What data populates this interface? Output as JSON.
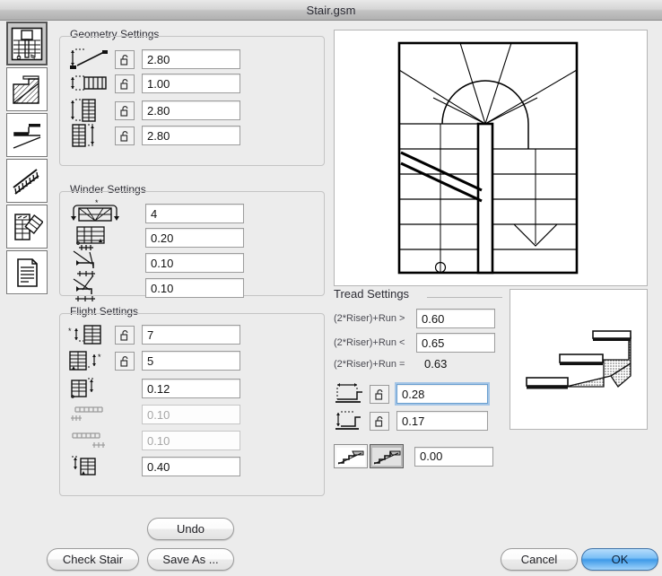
{
  "window": {
    "title": "Stair.gsm"
  },
  "sidebar": {
    "items": [
      {
        "name": "stair-plan",
        "label": "Stair Plan View",
        "selected": true
      },
      {
        "name": "stair-section",
        "label": "Stair Section",
        "selected": false
      },
      {
        "name": "stair-landing",
        "label": "Landing Detail",
        "selected": false
      },
      {
        "name": "stair-railing",
        "label": "Railing",
        "selected": false
      },
      {
        "name": "stair-winder",
        "label": "Winder Layout",
        "selected": false
      },
      {
        "name": "stair-listing",
        "label": "Listing / Document",
        "selected": false
      }
    ]
  },
  "geometry": {
    "title": "Geometry Settings",
    "rows": [
      {
        "icon": "stair-height-run-icon",
        "locked": false,
        "value": "2.80"
      },
      {
        "icon": "stair-width-icon",
        "locked": false,
        "value": "1.00"
      },
      {
        "icon": "stair-length-plan-icon",
        "locked": false,
        "value": "2.80"
      },
      {
        "icon": "stair-total-length-icon",
        "locked": false,
        "value": "2.80"
      }
    ]
  },
  "winder": {
    "title": "Winder Settings",
    "rows": [
      {
        "icon": "winder-count-icon",
        "value": "4"
      },
      {
        "icon": "winder-offset-icon",
        "value": "0.20"
      },
      {
        "icon": "winder-inner-goings-icon",
        "value": "0.10"
      },
      {
        "icon": "winder-outer-goings-icon",
        "value": "0.10"
      }
    ]
  },
  "flight": {
    "title": "Flight Settings",
    "rows": [
      {
        "icon": "risers-up-icon",
        "hasLock": true,
        "locked": false,
        "value": "7",
        "disabled": false
      },
      {
        "icon": "risers-down-icon",
        "hasLock": true,
        "locked": false,
        "value": "5",
        "disabled": false
      },
      {
        "icon": "flight-step-height-icon",
        "hasLock": false,
        "value": "0.12",
        "disabled": false
      },
      {
        "icon": "flight-start-offset-icon",
        "hasLock": false,
        "value": "0.10",
        "disabled": true
      },
      {
        "icon": "flight-end-offset-icon",
        "hasLock": false,
        "value": "0.10",
        "disabled": true
      },
      {
        "icon": "flight-landing-depth-icon",
        "hasLock": false,
        "value": "0.40",
        "disabled": false
      }
    ]
  },
  "tread": {
    "title": "Tread Settings",
    "formula_rows": [
      {
        "label": "(2*Riser)+Run >",
        "value": "0.60",
        "editable": true
      },
      {
        "label": "(2*Riser)+Run <",
        "value": "0.65",
        "editable": true
      },
      {
        "label": "(2*Riser)+Run =",
        "value": "0.63",
        "editable": false
      }
    ],
    "dimension_rows": [
      {
        "icon": "tread-run-icon",
        "locked": false,
        "value": "0.28",
        "focused": true
      },
      {
        "icon": "tread-riser-icon",
        "locked": false,
        "value": "0.17",
        "focused": false
      }
    ],
    "nosing": {
      "option_a": {
        "icon": "nosing-flush-icon",
        "selected": false
      },
      "option_b": {
        "icon": "nosing-overhang-icon",
        "selected": true
      },
      "value": "0.00"
    }
  },
  "footer": {
    "undo": "Undo",
    "check_stair": "Check Stair",
    "save_as": "Save As ...",
    "cancel": "Cancel",
    "ok": "OK"
  },
  "colors": {
    "window_bg": "#ececec",
    "accent_blue": "#3f9ae8",
    "focus_ring": "#6aa5e1",
    "field_bg": "#ffffff",
    "disabled_text": "#a6a6a6"
  }
}
